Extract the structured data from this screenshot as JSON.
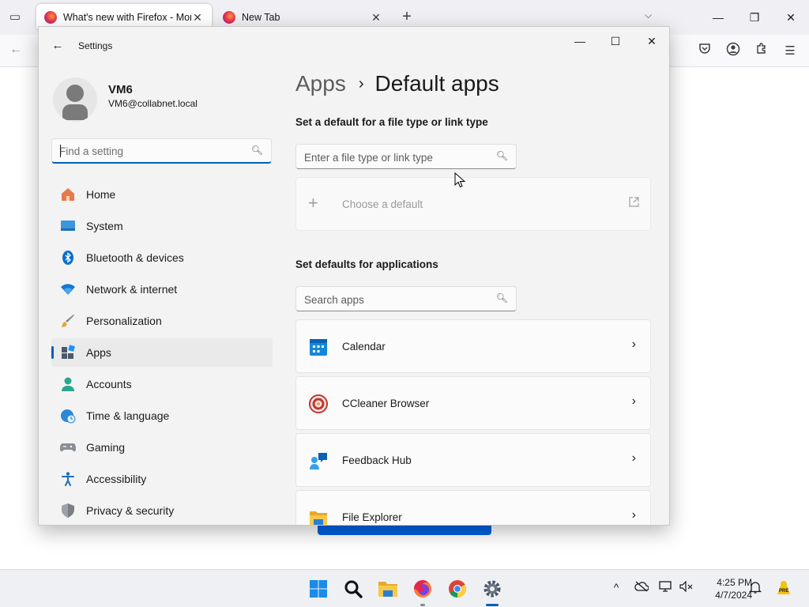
{
  "firefox": {
    "tabs": [
      {
        "title": "What's new with Firefox - More"
      },
      {
        "title": "New Tab"
      }
    ],
    "new_tab_glyph": "+",
    "all_tabs_glyph": "⌵"
  },
  "settings": {
    "app_title": "Settings",
    "user": {
      "name": "VM6",
      "email": "VM6@collabnet.local"
    },
    "find_placeholder": "Find a setting",
    "nav": [
      {
        "label": "Home",
        "icon": "home-icon"
      },
      {
        "label": "System",
        "icon": "system-icon"
      },
      {
        "label": "Bluetooth & devices",
        "icon": "bluetooth-icon"
      },
      {
        "label": "Network & internet",
        "icon": "wifi-icon"
      },
      {
        "label": "Personalization",
        "icon": "brush-icon"
      },
      {
        "label": "Apps",
        "icon": "apps-icon",
        "selected": true
      },
      {
        "label": "Accounts",
        "icon": "person-icon"
      },
      {
        "label": "Time & language",
        "icon": "globe-clock-icon"
      },
      {
        "label": "Gaming",
        "icon": "gamepad-icon"
      },
      {
        "label": "Accessibility",
        "icon": "accessibility-icon"
      },
      {
        "label": "Privacy & security",
        "icon": "shield-icon"
      }
    ],
    "breadcrumb": {
      "parent": "Apps",
      "current": "Default apps"
    },
    "file_type_section": {
      "title": "Set a default for a file type or link type",
      "placeholder": "Enter a file type or link type",
      "choose_label": "Choose a default"
    },
    "apps_section": {
      "title": "Set defaults for applications",
      "placeholder": "Search apps",
      "apps": [
        {
          "name": "Calendar",
          "icon": "calendar-icon"
        },
        {
          "name": "CCleaner Browser",
          "icon": "ccleaner-browser-icon"
        },
        {
          "name": "Feedback Hub",
          "icon": "feedback-hub-icon"
        },
        {
          "name": "File Explorer",
          "icon": "file-explorer-icon"
        }
      ]
    }
  },
  "taskbar": {
    "time": "4:25 PM",
    "date": "4/7/2024",
    "pre_badge": "PRE"
  },
  "colors": {
    "accent": "#005fb8",
    "firefox_blue": "#0061e0"
  }
}
